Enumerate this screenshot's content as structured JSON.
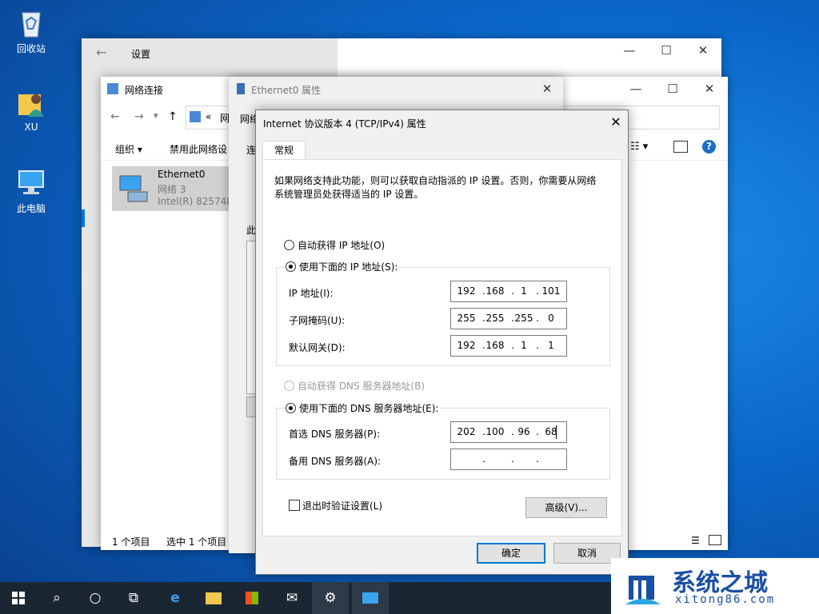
{
  "desktop": {
    "icons": [
      {
        "label": "回收站",
        "icon": "recycle-bin-icon"
      },
      {
        "label": "XU",
        "icon": "user-folder-icon"
      },
      {
        "label": "此电脑",
        "icon": "computer-icon"
      }
    ]
  },
  "settings_window": {
    "back": "←",
    "title": "设置"
  },
  "netconn_window": {
    "title": "网络连接",
    "address_prefix": "«",
    "address_text": "网",
    "organize_label": "组织 ▾",
    "disable_label": "禁用此网络设",
    "item": {
      "name": "Ethernet0",
      "network": "网络 3",
      "adapter": "Intel(R) 82574L"
    },
    "status_count": "1 个项目",
    "status_selected": "选中 1 个项目"
  },
  "props_window": {
    "title": "Ethernet0 属性",
    "tab_partial": "网络",
    "connect_partial": "连",
    "list_partial": "此"
  },
  "ipv4_dialog": {
    "title": "Internet 协议版本 4 (TCP/IPv4) 属性",
    "tab_general": "常规",
    "description": "如果网络支持此功能，则可以获取自动指派的 IP 设置。否则，你需要从网络系统管理员处获得适当的 IP 设置。",
    "auto_ip_label": "自动获得 IP 地址(O)",
    "manual_ip_label": "使用下面的 IP 地址(S):",
    "ip_label": "IP 地址(I):",
    "ip_value": [
      "192",
      "168",
      "1",
      "101"
    ],
    "mask_label": "子网掩码(U):",
    "mask_value": [
      "255",
      "255",
      "255",
      "0"
    ],
    "gateway_label": "默认网关(D):",
    "gateway_value": [
      "192",
      "168",
      "1",
      "1"
    ],
    "auto_dns_label": "自动获得 DNS 服务器地址(B)",
    "manual_dns_label": "使用下面的 DNS 服务器地址(E):",
    "pref_dns_label": "首选 DNS 服务器(P):",
    "pref_dns_value": [
      "202",
      "100",
      "96",
      "68"
    ],
    "alt_dns_label": "备用 DNS 服务器(A):",
    "alt_dns_value": [
      "",
      "",
      "",
      ""
    ],
    "validate_label": "退出时验证设置(L)",
    "advanced_label": "高级(V)...",
    "ok_label": "确定",
    "cancel_label": "取消"
  },
  "watermark": {
    "brand": "系统之城",
    "url": "xitong86.com"
  },
  "colors": {
    "desktop_blue": "#0a66c8",
    "taskbar": "#1b2633",
    "accent": "#0078d7",
    "brand_blue": "#1a4fa3"
  }
}
